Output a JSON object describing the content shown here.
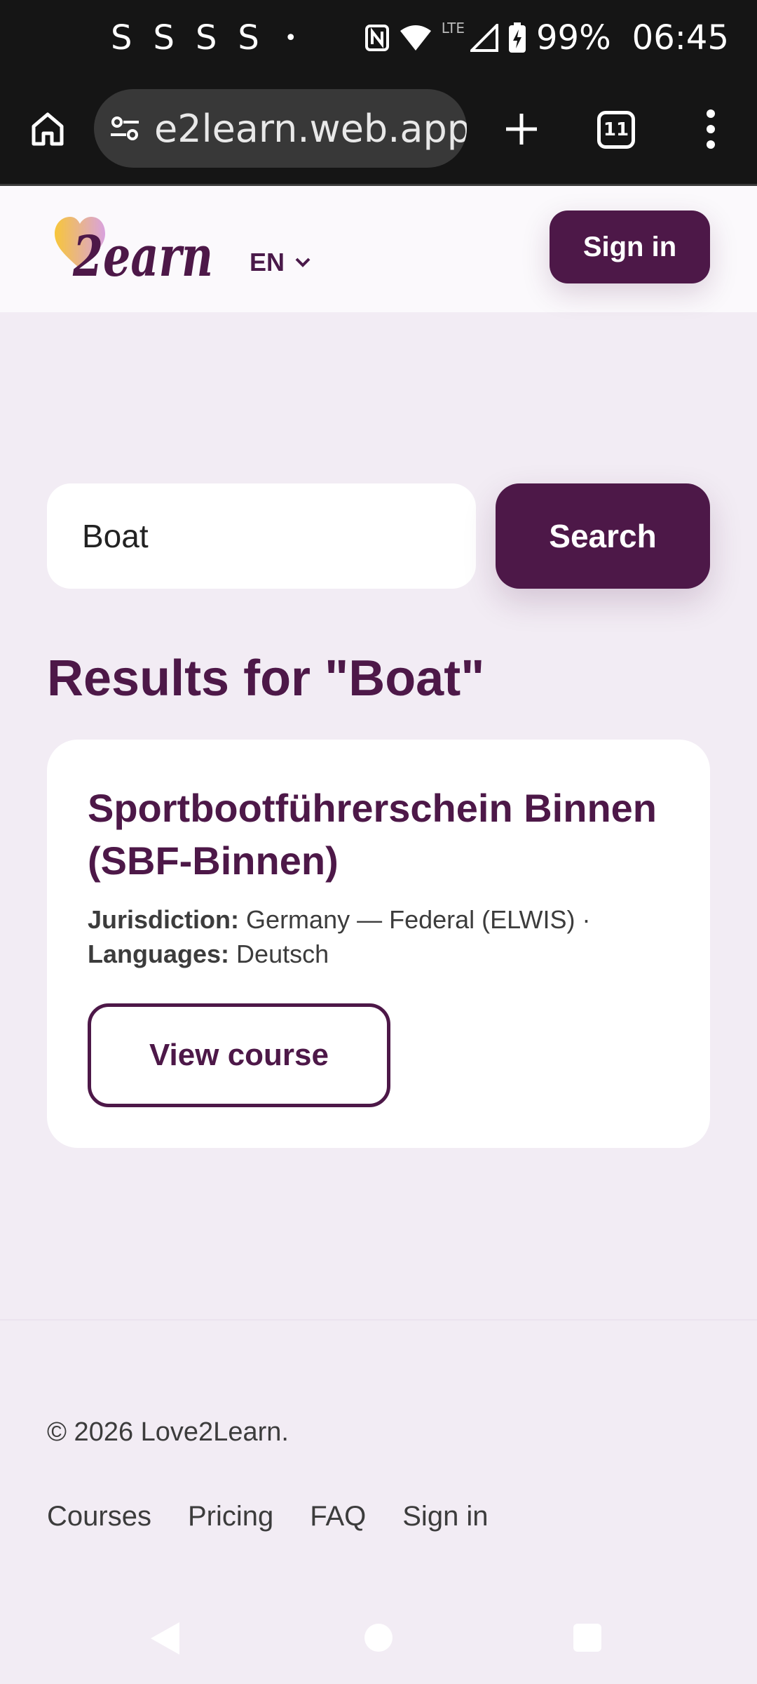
{
  "status_bar": {
    "notifications": [
      "S",
      "S",
      "S",
      "S"
    ],
    "dot": "•",
    "network": "LTE",
    "battery": "99%",
    "time": "06:45"
  },
  "browser": {
    "url": "e2learn.web.app",
    "tab_count": "11"
  },
  "header": {
    "logo_alt": "Love2Learn",
    "logo_text": "2earn",
    "language": "EN",
    "sign_in": "Sign in"
  },
  "search": {
    "query": "Boat",
    "button": "Search"
  },
  "results": {
    "heading": "Results for \"Boat\"",
    "items": [
      {
        "title": "Sportbootführerschein Binnen (SBF-Binnen)",
        "jurisdiction_label": "Jurisdiction:",
        "jurisdiction": "Germany — Federal (ELWIS) ·",
        "languages_label": "Languages:",
        "languages": "Deutsch",
        "button": "View course"
      }
    ]
  },
  "footer": {
    "copyright": "© 2026 Love2Learn.",
    "links": [
      "Courses",
      "Pricing",
      "FAQ",
      "Sign in"
    ]
  },
  "colors": {
    "brand": "#4d1848",
    "page_bg": "#f2ecf4",
    "header_bg": "#fbf9fc",
    "heart_gradient": [
      "#f7c63a",
      "#d9a2de"
    ]
  }
}
